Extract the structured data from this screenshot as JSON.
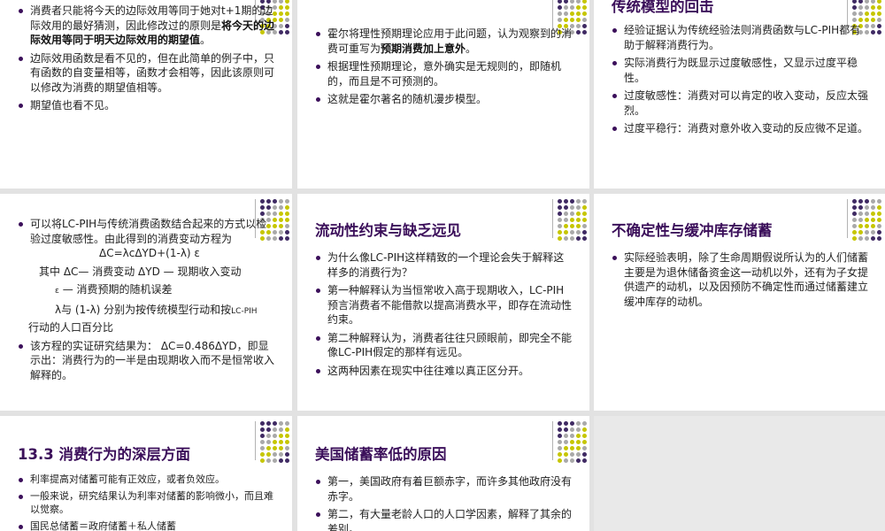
{
  "colors": {
    "title": "#3b0f5a",
    "dot_purple": "#3f2a63",
    "dot_grey": "#a9a9a9",
    "dot_yellow": "#c6c600",
    "background": "#e2e2e2"
  },
  "slides": {
    "s1": {
      "items": [
        {
          "before": "消费者只能将今天的边际效用等同于她对t+1期的边际效用的最好猜测，因此修改过的原则是",
          "bold": "将今天的边际效用等同于明天边际效用的期望值",
          "after": "。"
        },
        {
          "text": "边际效用函数是看不见的，但在此简单的例子中，只有函数的自变量相等，函数才会相等，因此该原则可以修改为消费的期望值相等。"
        },
        {
          "text": "期望值也看不见。"
        }
      ]
    },
    "s2": {
      "items": [
        {
          "before": "霍尔将理性预期理论应用于此问题，认为观察到的消费可重写为",
          "bold": "预期消费加上意外",
          "after": "。"
        },
        {
          "text": "根据理性预期理论，意外确实是无规则的，即随机的，而且是不可预测的。"
        },
        {
          "text": "这就是霍尔著名的随机漫步模型。"
        }
      ]
    },
    "s3": {
      "title": "传统模型的回击",
      "items": [
        {
          "text": "经验证据认为传统经验法则消费函数与LC-PIH都有助于解释消费行为。"
        },
        {
          "text": "实际消费行为既显示过度敏感性，又显示过度平稳性。"
        },
        {
          "text": "过度敏感性：消费对可以肯定的收入变动，反应太强烈。"
        },
        {
          "text": "过度平稳行：消费对意外收入变动的反应微不足道。"
        }
      ]
    },
    "s4": {
      "item1": "可以将LC-PIH与传统消费函数结合起来的方式以检验过度敏感性。由此得到的消费变动方程为",
      "equation": "ΔC=λcΔYD+(1-λ) ε",
      "line_a": "其中 ΔC— 消费变动  ΔYD — 现期收入变动",
      "line_b_sym": "ε",
      "line_b": " — 消费预期的随机误差",
      "line_c": "λ与 (1-λ) 分别为按传统模型行动和按",
      "line_c_small": "LC-PIH",
      "line_c2": "行动的人口百分比",
      "item2_before": "该方程的实证研究结果为：",
      "item2_eq": "ΔC=0.486ΔYD，",
      "item2_after": "即显示出：消费行为的一半是由现期收入而不是恒常收入解释的。"
    },
    "s5": {
      "title": "流动性约束与缺乏远见",
      "items": [
        {
          "text": "为什么像LC-PIH这样精致的一个理论会失于解释这样多的消费行为？"
        },
        {
          "text": "第一种解释认为当恒常收入高于现期收入，LC-PIH预言消费者不能借款以提高消费水平，即存在流动性约束。"
        },
        {
          "text": "第二种解释认为，消费者往往只顾眼前，即完全不能像LC-PIH假定的那样有远见。"
        },
        {
          "text": "这两种因素在现实中往往难以真正区分开。"
        }
      ]
    },
    "s6": {
      "title": "不确定性与缓冲库存储蓄",
      "items": [
        {
          "text": "实际经验表明，除了生命周期假说所认为的人们储蓄主要是为退休储备资金这一动机以外，还有为子女提供遗产的动机，以及因预防不确定性而通过储蓄建立缓冲库存的动机。"
        }
      ]
    },
    "s7": {
      "title": "13.3  消费行为的深层方面",
      "items": [
        {
          "text": "利率提高对储蓄可能有正效应，或者负效应。"
        },
        {
          "text": "一般来说，研究结果认为利率对储蓄的影响微小，而且难以觉察。"
        },
        {
          "text": "国民总储蓄＝政府储蓄＋私人储蓄"
        }
      ]
    },
    "s8": {
      "title": "美国储蓄率低的原因",
      "items": [
        {
          "text": "第一，美国政府有着巨额赤字，而许多其他政府没有赤字。"
        },
        {
          "text": "第二，有大量老龄人口的人口学因素，解释了其余的差别。"
        }
      ]
    }
  }
}
